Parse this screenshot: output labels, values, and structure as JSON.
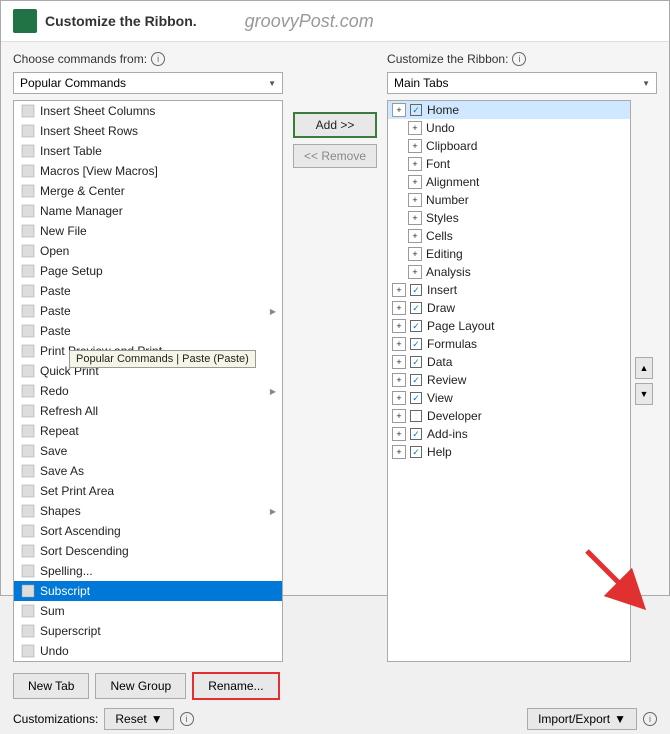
{
  "title": "Customize the Ribbon.",
  "watermark": "groovyPost.com",
  "left": {
    "label": "Choose commands from:",
    "dropdown_value": "Popular Commands",
    "items": [
      {
        "icon": "grid",
        "label": "Insert Sheet Columns",
        "arrow": false
      },
      {
        "icon": "rows",
        "label": "Insert Sheet Rows",
        "arrow": false
      },
      {
        "icon": "table",
        "label": "Insert Table",
        "arrow": false
      },
      {
        "icon": "play",
        "label": "Macros [View Macros]",
        "arrow": false
      },
      {
        "icon": "merge",
        "label": "Merge & Center",
        "arrow": false
      },
      {
        "icon": "name",
        "label": "Name Manager",
        "arrow": false
      },
      {
        "icon": "file",
        "label": "New File",
        "arrow": false
      },
      {
        "icon": "open",
        "label": "Open",
        "arrow": false
      },
      {
        "icon": "setup",
        "label": "Page Setup",
        "arrow": false
      },
      {
        "icon": "paste",
        "label": "Paste",
        "arrow": false
      },
      {
        "icon": "paste2",
        "label": "Paste",
        "arrow": true
      },
      {
        "icon": "paste3",
        "label": "Paste",
        "arrow": false,
        "selected": false,
        "tooltip": true
      },
      {
        "icon": "preview",
        "label": "Print Preview and Print",
        "arrow": false
      },
      {
        "icon": "quickprint",
        "label": "Quick Print",
        "arrow": false
      },
      {
        "icon": "redo",
        "label": "Redo",
        "arrow": true
      },
      {
        "icon": "refresh",
        "label": "Refresh All",
        "arrow": false
      },
      {
        "icon": "repeat",
        "label": "Repeat",
        "arrow": false
      },
      {
        "icon": "save",
        "label": "Save",
        "arrow": false
      },
      {
        "icon": "saveas",
        "label": "Save As",
        "arrow": false
      },
      {
        "icon": "printarea",
        "label": "Set Print Area",
        "arrow": false
      },
      {
        "icon": "shapes",
        "label": "Shapes",
        "arrow": true
      },
      {
        "icon": "sortasc",
        "label": "Sort Ascending",
        "arrow": false
      },
      {
        "icon": "sortdesc",
        "label": "Sort Descending",
        "arrow": false
      },
      {
        "icon": "spell",
        "label": "Spelling...",
        "arrow": false
      },
      {
        "icon": "subscript",
        "label": "Subscript",
        "arrow": false,
        "selected": true
      },
      {
        "icon": "sum",
        "label": "Sum",
        "arrow": false
      },
      {
        "icon": "superscript",
        "label": "Superscript",
        "arrow": false
      },
      {
        "icon": "undo",
        "label": "Undo",
        "arrow": false
      }
    ],
    "tooltip_text": "Popular Commands | Paste (Paste)"
  },
  "middle": {
    "add_label": "Add >>",
    "remove_label": "<< Remove"
  },
  "right": {
    "label": "Customize the Ribbon:",
    "dropdown_value": "Main Tabs",
    "items": [
      {
        "level": 0,
        "expand": true,
        "checked": true,
        "label": "Home",
        "header": true,
        "selected": true
      },
      {
        "level": 1,
        "expand": true,
        "checked": false,
        "label": "Undo",
        "header": false
      },
      {
        "level": 1,
        "expand": true,
        "checked": false,
        "label": "Clipboard",
        "header": false
      },
      {
        "level": 1,
        "expand": true,
        "checked": false,
        "label": "Font",
        "header": false
      },
      {
        "level": 1,
        "expand": true,
        "checked": false,
        "label": "Alignment",
        "header": false
      },
      {
        "level": 1,
        "expand": true,
        "checked": false,
        "label": "Number",
        "header": false
      },
      {
        "level": 1,
        "expand": true,
        "checked": false,
        "label": "Styles",
        "header": false
      },
      {
        "level": 1,
        "expand": true,
        "checked": false,
        "label": "Cells",
        "header": false
      },
      {
        "level": 1,
        "expand": true,
        "checked": false,
        "label": "Editing",
        "header": false
      },
      {
        "level": 1,
        "expand": true,
        "checked": false,
        "label": "Analysis",
        "header": false
      },
      {
        "level": 0,
        "expand": true,
        "checked": true,
        "label": "Insert",
        "header": true
      },
      {
        "level": 0,
        "expand": true,
        "checked": true,
        "label": "Draw",
        "header": true
      },
      {
        "level": 0,
        "expand": true,
        "checked": true,
        "label": "Page Layout",
        "header": true
      },
      {
        "level": 0,
        "expand": true,
        "checked": true,
        "label": "Formulas",
        "header": true
      },
      {
        "level": 0,
        "expand": true,
        "checked": true,
        "label": "Data",
        "header": true
      },
      {
        "level": 0,
        "expand": true,
        "checked": true,
        "label": "Review",
        "header": true
      },
      {
        "level": 0,
        "expand": true,
        "checked": true,
        "label": "View",
        "header": true
      },
      {
        "level": 0,
        "expand": true,
        "checked": false,
        "label": "Developer",
        "header": true
      },
      {
        "level": 0,
        "expand": true,
        "checked": true,
        "label": "Add-ins",
        "header": true
      },
      {
        "level": 0,
        "expand": true,
        "checked": true,
        "label": "Help",
        "header": true
      }
    ]
  },
  "bottom": {
    "new_tab_label": "New Tab",
    "new_group_label": "New Group",
    "rename_label": "Rename...",
    "customizations_label": "Customizations:",
    "reset_label": "Reset",
    "reset_arrow": "▼",
    "import_export_label": "Import/Export",
    "import_export_arrow": "▼"
  }
}
